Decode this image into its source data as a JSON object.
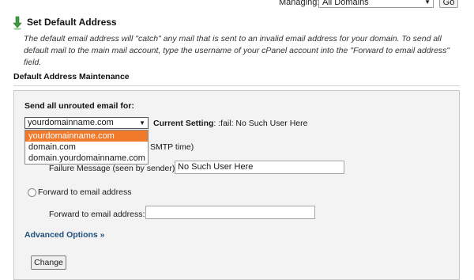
{
  "header": {
    "managing_label": "Managing:",
    "managing_value": "All Domains",
    "go_label": "Go"
  },
  "page": {
    "title": "Set Default Address",
    "description": "The default email address will \"catch\" any mail that is sent to an invalid email address for your domain. To send all default mail to the main mail account, type the username of your cPanel account into the \"Forward to email address\" field."
  },
  "section": {
    "title": "Default Address Maintenance",
    "unrouted_label": "Send all unrouted email for:",
    "selected_domain": "yourdomainname.com",
    "domain_options": [
      "yourdomainname.com",
      "domain.com",
      "domain.yourdomainname.com"
    ],
    "current_setting_label": "Current Setting",
    "current_setting_value": ": :fail: No Such User Here",
    "smtp_tail": "SMTP time)",
    "failure_message_label": "Failure Message (seen by sender):",
    "failure_message_value": "No Such User Here",
    "forward_radio_label": "Forward to email address",
    "forward_label": "Forward to email address:",
    "forward_value": "",
    "advanced_link": "Advanced Options »",
    "change_button": "Change"
  },
  "colors": {
    "highlight": "#f07a2a",
    "link": "#1f4f7d",
    "panel": "#f3f3f3"
  }
}
